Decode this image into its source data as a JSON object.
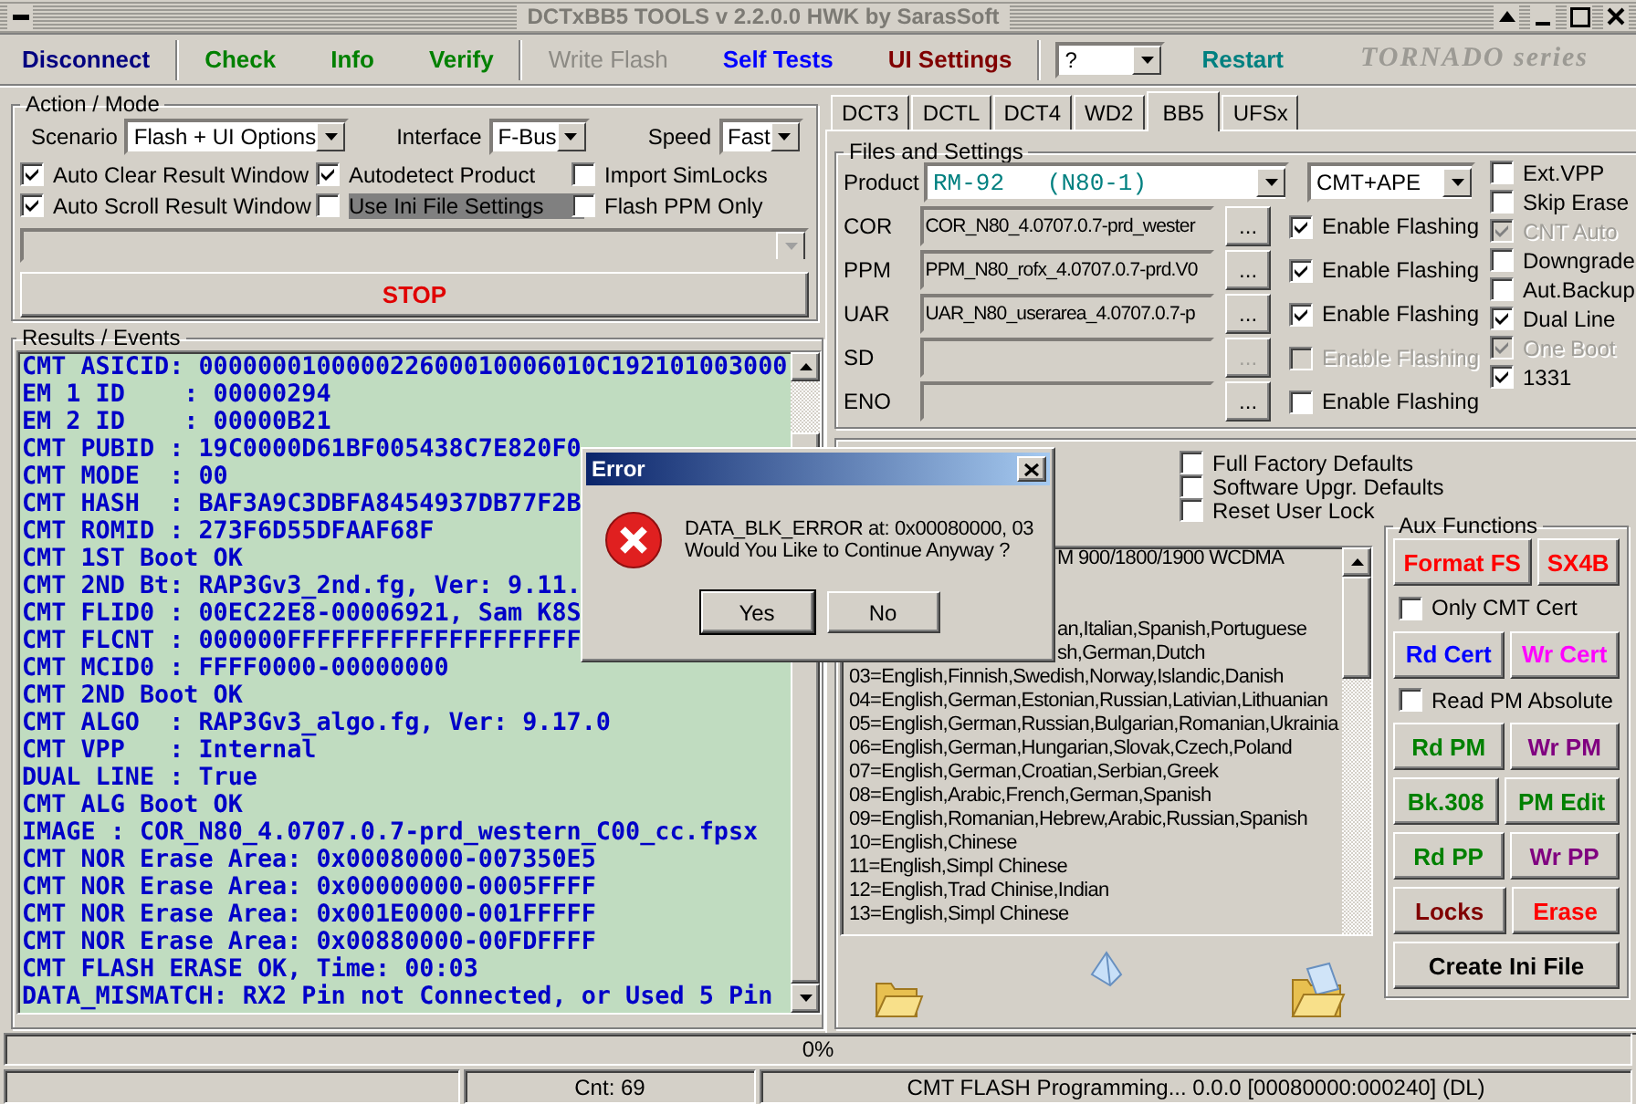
{
  "window": {
    "title": "DCTxBB5 TOOLS v 2.2.0.0 HWK by SarasSoft"
  },
  "toolbar": {
    "groups": [
      {
        "buttons": [
          {
            "label": "Disconnect",
            "color": "#000080",
            "disabled": false
          }
        ]
      },
      {
        "buttons": [
          {
            "label": "Check",
            "color": "#008000",
            "disabled": false
          },
          {
            "label": "Info",
            "color": "#008000",
            "disabled": false
          },
          {
            "label": "Verify",
            "color": "#008000",
            "disabled": false
          }
        ]
      },
      {
        "buttons": [
          {
            "label": "Write Flash",
            "color": "#8c8a84",
            "disabled": true
          },
          {
            "label": "Self Tests",
            "color": "#0000ff",
            "disabled": false
          },
          {
            "label": "UI Settings",
            "color": "#800000",
            "disabled": false
          }
        ]
      }
    ],
    "help_dropdown": {
      "value": "?"
    },
    "restart": {
      "label": "Restart",
      "color": "#008080"
    },
    "logo": "TORNADO series"
  },
  "action_mode": {
    "title": "Action / Mode",
    "selectors": [
      {
        "label": "Scenario",
        "value": "Flash + UI Options"
      },
      {
        "label": "Interface",
        "value": "F-Bus"
      },
      {
        "label": "Speed",
        "value": "Fast"
      }
    ],
    "options": [
      {
        "label": "Auto Clear Result Window",
        "checked": true,
        "highlighted": false
      },
      {
        "label": "Autodetect Product",
        "checked": true,
        "highlighted": false
      },
      {
        "label": "Import SimLocks",
        "checked": false,
        "highlighted": false
      },
      {
        "label": "Auto Scroll Result Window",
        "checked": true,
        "highlighted": false
      },
      {
        "label": "Use Ini File Settings",
        "checked": false,
        "highlighted": true
      },
      {
        "label": "Flash PPM Only",
        "checked": false,
        "highlighted": false
      }
    ],
    "command_dropdown": {
      "disabled": true
    },
    "stop_button": "STOP"
  },
  "results": {
    "title": "Results / Events",
    "lines": [
      "CMT ASICID: 000000010000022600010006010C192101003000",
      "EM 1 ID    : 00000294",
      "EM 2 ID    : 00000B21",
      "CMT PUBID : 19C0000D61BF005438C7E820F0",
      "CMT MODE  : 00",
      "CMT HASH  : BAF3A9C3DBFA8454937DB77F2B",
      "CMT ROMID : 273F6D55DFAAF68F",
      "CMT 1ST Boot OK",
      "CMT 2ND Bt: RAP3Gv3_2nd.fg, Ver: 9.11.",
      "CMT FLID0 : 00EC22E8-00006921, Sam K8S",
      "CMT FLCNT : 000000FFFFFFFFFFFFFFFFFFFF",
      "CMT MCID0 : FFFF0000-00000000",
      "CMT 2ND Boot OK",
      "CMT ALGO  : RAP3Gv3_algo.fg, Ver: 9.17.0",
      "CMT VPP   : Internal",
      "DUAL LINE : True",
      "CMT ALG Boot OK",
      "IMAGE : COR_N80_4.0707.0.7-prd_western_C00_cc.fpsx",
      "CMT NOR Erase Area: 0x00080000-007350E5",
      "CMT NOR Erase Area: 0x00000000-0005FFFF",
      "CMT NOR Erase Area: 0x001E0000-001FFFFF",
      "CMT NOR Erase Area: 0x00880000-00FDFFFF",
      "CMT FLASH ERASE OK, Time: 00:03",
      "DATA_MISMATCH: RX2 Pin not Connected, or Used 5 Pin"
    ]
  },
  "tabs": [
    {
      "label": "DCT3",
      "selected": false
    },
    {
      "label": "DCTL",
      "selected": false
    },
    {
      "label": "DCT4",
      "selected": false
    },
    {
      "label": "WD2",
      "selected": false
    },
    {
      "label": "BB5",
      "selected": true
    },
    {
      "label": "UFSx",
      "selected": false
    }
  ],
  "files": {
    "title": "Files and Settings",
    "product": {
      "label": "Product",
      "value": "RM-92   (N80-1)"
    },
    "mode": {
      "value": "CMT+APE"
    },
    "rows": [
      {
        "label": "COR",
        "value": "COR_N80_4.0707.0.7-prd_wester",
        "browse": "...",
        "browse_disabled": false,
        "flash_label": "Enable Flashing",
        "checked": true,
        "disabled": false
      },
      {
        "label": "PPM",
        "value": "PPM_N80_rofx_4.0707.0.7-prd.V0",
        "browse": "...",
        "browse_disabled": false,
        "flash_label": "Enable Flashing",
        "checked": true,
        "disabled": false
      },
      {
        "label": "UAR",
        "value": "UAR_N80_userarea_4.0707.0.7-p",
        "browse": "...",
        "browse_disabled": false,
        "flash_label": "Enable Flashing",
        "checked": true,
        "disabled": false
      },
      {
        "label": "SD",
        "browse": "...",
        "browse_disabled": true,
        "flash_label": "Enable Flashing",
        "checked": false,
        "disabled": true
      },
      {
        "label": "ENO",
        "browse": "...",
        "browse_disabled": false,
        "flash_label": "Enable Flashing",
        "checked": false,
        "disabled": false
      }
    ],
    "options": [
      {
        "label": "Ext.VPP",
        "checked": false,
        "disabled": false
      },
      {
        "label": "Skip Erase",
        "checked": false,
        "disabled": false
      },
      {
        "label": "CNT Auto",
        "checked": true,
        "disabled": true
      },
      {
        "label": "Downgrade",
        "checked": false,
        "disabled": false
      },
      {
        "label": "Aut.Backup",
        "checked": false,
        "disabled": false
      },
      {
        "label": "Dual Line",
        "checked": true,
        "disabled": false
      },
      {
        "label": "One Boot",
        "checked": true,
        "disabled": true
      },
      {
        "label": "1331",
        "checked": true,
        "disabled": false
      }
    ]
  },
  "ui_settings": {
    "options": [
      {
        "label": "Full Factory Defaults",
        "checked": false
      },
      {
        "label": "Software Upgr. Defaults",
        "checked": false
      },
      {
        "label": "Reset User Lock",
        "checked": false
      }
    ],
    "list": [
      {
        "kind": "cut",
        "text": "M 900/1800/1900   WCDMA"
      },
      {
        "kind": "covered"
      },
      {
        "kind": "covered"
      },
      {
        "kind": "cut",
        "text": "an,Italian,Spanish,Portuguese"
      },
      {
        "kind": "cut",
        "text": "sh,German,Dutch"
      },
      {
        "kind": "line",
        "text": "03=English,Finnish,Swedish,Norway,Islandic,Danish"
      },
      {
        "kind": "line",
        "text": "04=English,German,Estonian,Russian,Lativian,Lithuanian"
      },
      {
        "kind": "line",
        "text": "05=English,German,Russian,Bulgarian,Romanian,Ukrainia"
      },
      {
        "kind": "line",
        "text": "06=English,German,Hungarian,Slovak,Czech,Poland"
      },
      {
        "kind": "line",
        "text": "07=English,German,Croatian,Serbian,Greek"
      },
      {
        "kind": "line",
        "text": "08=English,Arabic,French,German,Spanish"
      },
      {
        "kind": "line",
        "text": "09=English,Romanian,Hebrew,Arabic,Russian,Spanish"
      },
      {
        "kind": "line",
        "text": "10=English,Chinese"
      },
      {
        "kind": "line",
        "text": "11=English,Simpl Chinese"
      },
      {
        "kind": "line",
        "text": "12=English,Trad Chinise,Indian"
      },
      {
        "kind": "line",
        "text": "13=English,Simpl Chinese"
      }
    ],
    "aux": {
      "title": "Aux Functions",
      "items": [
        {
          "kind": "buttons",
          "buttons": [
            {
              "label": "Format FS",
              "color": "#ff0000"
            },
            {
              "label": "SX4B",
              "color": "#ff0000"
            }
          ]
        },
        {
          "kind": "checkbox",
          "label": "Only CMT Cert",
          "checked": false
        },
        {
          "kind": "buttons",
          "buttons": [
            {
              "label": "Rd Cert",
              "color": "#0000ff"
            },
            {
              "label": "Wr Cert",
              "color": "#ff00ff"
            }
          ]
        },
        {
          "kind": "checkbox",
          "label": "Read PM Absolute",
          "checked": false
        },
        {
          "kind": "buttons",
          "buttons": [
            {
              "label": "Rd PM",
              "color": "#008000"
            },
            {
              "label": "Wr PM",
              "color": "#800080"
            }
          ]
        },
        {
          "kind": "buttons",
          "buttons": [
            {
              "label": "Bk.308",
              "color": "#008000"
            },
            {
              "label": "PM Edit",
              "color": "#008000"
            }
          ]
        },
        {
          "kind": "buttons",
          "buttons": [
            {
              "label": "Rd PP",
              "color": "#008000"
            },
            {
              "label": "Wr PP",
              "color": "#800080"
            }
          ]
        },
        {
          "kind": "buttons",
          "buttons": [
            {
              "label": "Locks",
              "color": "#800000"
            },
            {
              "label": "Erase",
              "color": "#ff0000"
            }
          ]
        },
        {
          "kind": "buttons",
          "buttons": [
            {
              "label": "Create Ini File",
              "color": "#000000"
            }
          ]
        }
      ]
    }
  },
  "dialog": {
    "title": "Error",
    "message": [
      "DATA_BLK_ERROR at: 0x00080000, 03",
      "Would You Like to Continue Anyway ?"
    ],
    "buttons": [
      {
        "label": "Yes",
        "focused": true
      },
      {
        "label": "No",
        "focused": false
      }
    ]
  },
  "progress": {
    "text": "0%",
    "level": 0
  },
  "status_bar": [
    {
      "text": "Cnt: 69"
    },
    {
      "text": "CMT FLASH Programming... 0.0.0 [00080000:000240] (DL)"
    }
  ]
}
